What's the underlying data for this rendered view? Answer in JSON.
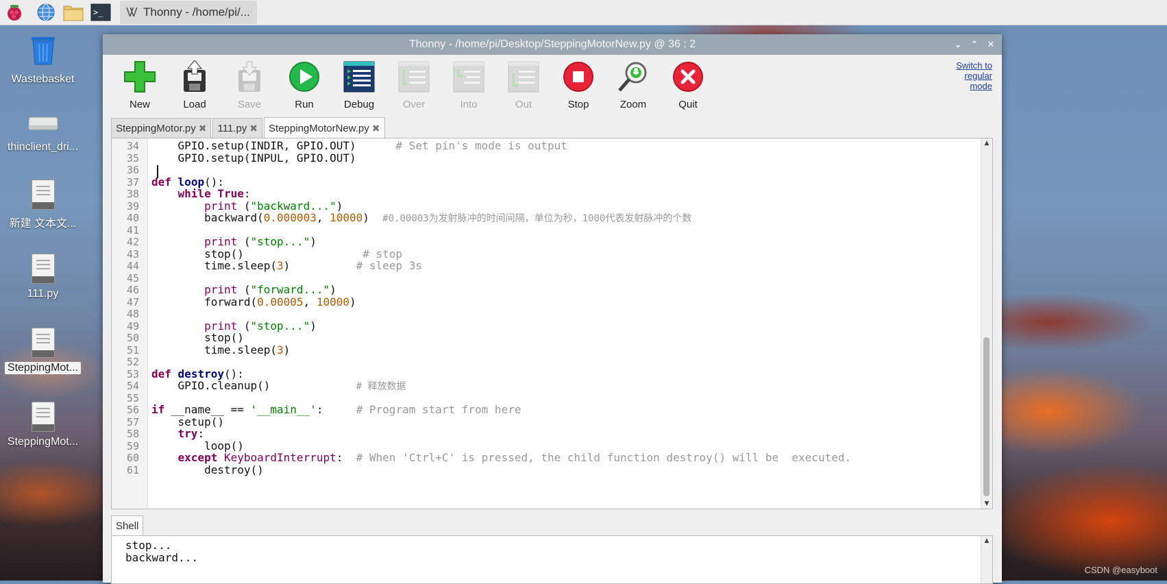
{
  "taskbar": {
    "task_title": "Thonny  -  /home/pi/..."
  },
  "desktop": {
    "icons": [
      {
        "label": "Wastebasket"
      },
      {
        "label": "thinclient_dri..."
      },
      {
        "label": "新建 文本文..."
      },
      {
        "label": "111.py"
      },
      {
        "label": "SteppingMot..."
      },
      {
        "label": "SteppingMot..."
      }
    ]
  },
  "window": {
    "title": "Thonny  -  /home/pi/Desktop/SteppingMotorNew.py  @  36 : 2"
  },
  "toolbar": {
    "new": "New",
    "load": "Load",
    "save": "Save",
    "run": "Run",
    "debug": "Debug",
    "over": "Over",
    "into": "Into",
    "out": "Out",
    "stop": "Stop",
    "zoom": "Zoom",
    "quit": "Quit",
    "switch_line1": "Switch to",
    "switch_line2": "regular",
    "switch_line3": "mode"
  },
  "tabs": [
    {
      "label": "SteppingMotor.py"
    },
    {
      "label": "111.py"
    },
    {
      "label": "SteppingMotorNew.py"
    }
  ],
  "editor": {
    "line_numbers": [
      "34",
      "35",
      "36",
      "37",
      "38",
      "39",
      "40",
      "41",
      "42",
      "43",
      "44",
      "45",
      "46",
      "47",
      "48",
      "49",
      "50",
      "51",
      "52",
      "53",
      "54",
      "55",
      "56",
      "57",
      "58",
      "59",
      "60",
      "61"
    ],
    "t": {
      "l34a": "    GPIO.setup(INDIR, GPIO.OUT)      ",
      "l34c": "# Set pin's mode is output",
      "l35": "    GPIO.setup(INPUL, GPIO.OUT)",
      "def": "def",
      "loop": "loop",
      "paren_colon": "():",
      "while": "while",
      "true": "True",
      "colon": ":",
      "print": "print",
      "s_backward": "\"backward...\"",
      "backward_call": "backward(",
      "n_0_000003": "0.000003",
      "comma": ", ",
      "n_10000": "10000",
      "l40c": "#0.00003为发射脉冲的时间间隔，单位为秒，1000代表发射脉冲的个数",
      "s_stop": "\"stop...\"",
      "stop_call": "stop()",
      "c_stop": "# stop",
      "sleep_call": "time.sleep(",
      "n_3": "3",
      "c_sleep": "# sleep 3s",
      "s_forward": "\"forward...\"",
      "forward_call": "forward(",
      "n_0_00005": "0.00005",
      "destroy": "destroy",
      "cleanup": "GPIO.cleanup()",
      "c_release": "# 释放数据",
      "if": "if",
      "name_eq": "__name__ == ",
      "s_main": "'__main__'",
      "c_start": "# Program start from here",
      "setup_call": "setup()",
      "try": "try",
      "loop_call": "loop()",
      "except": "except",
      "kbint": "KeyboardInterrupt",
      "c_ctrlc": "# When 'Ctrl+C' is pressed, the child function destroy() will be  executed.",
      "destroy_call": "destroy()"
    }
  },
  "shell": {
    "tab_label": "Shell",
    "lines": [
      "stop...",
      "backward..."
    ]
  },
  "watermark": "CSDN @easyboot"
}
